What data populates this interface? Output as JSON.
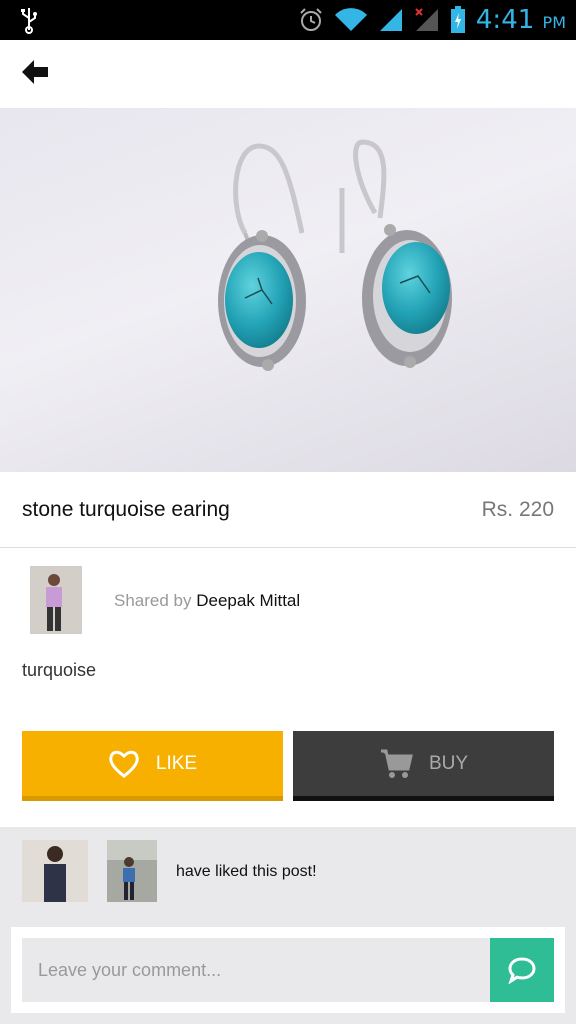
{
  "status_bar": {
    "time": "4:41",
    "ampm": "PM",
    "icons": [
      "usb-icon",
      "alarm-icon",
      "wifi-icon",
      "signal-icon",
      "no-signal-icon",
      "battery-charging-icon"
    ],
    "accent": "#33b5e5"
  },
  "nav": {
    "back_icon": "back-arrow-icon"
  },
  "product": {
    "title": "stone turquoise earing",
    "price": "Rs. 220",
    "image": "turquoise-earrings-photo"
  },
  "share": {
    "prefix": "Shared by",
    "user": "Deepak Mittal"
  },
  "description": "turquoise",
  "actions": {
    "like_label": "LIKE",
    "buy_label": "BUY",
    "like_color": "#f7b000",
    "buy_color": "#3d3d3d"
  },
  "likes": {
    "text": "have liked this post!"
  },
  "comment": {
    "placeholder": "Leave your comment...",
    "send_color": "#2ebd94"
  }
}
